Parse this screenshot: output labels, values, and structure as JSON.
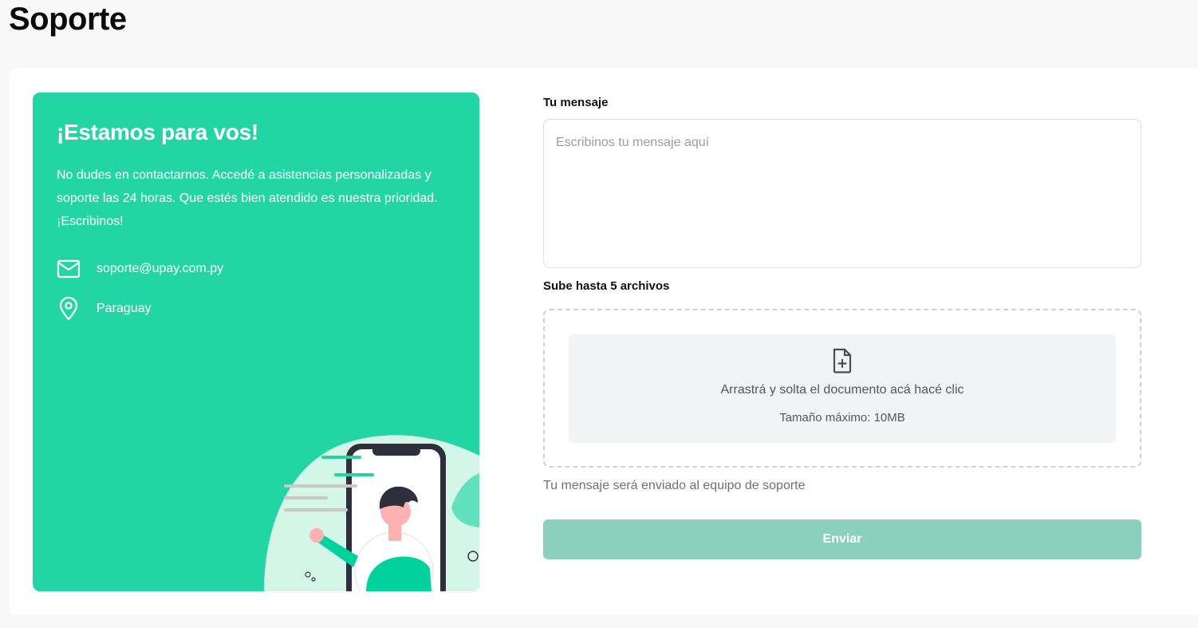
{
  "page": {
    "title": "Soporte"
  },
  "promo": {
    "heading": "¡Estamos para vos!",
    "description": "No dudes en contactarnos. Accedé a asistencias personalizadas y soporte las 24 horas. Que estés bien atendido es nuestra prioridad. ¡Escribinos!",
    "email": "soporte@upay.com.py",
    "location": "Paraguay",
    "email_icon": "mail-icon",
    "location_icon": "map-pin-icon",
    "background_color": "#23d4a4"
  },
  "form": {
    "message_label": "Tu mensaje",
    "message_placeholder": "Escribinos tu mensaje aquí",
    "message_value": "",
    "files_label": "Sube hasta 5 archivos",
    "dropzone_text": "Arrastrá y solta el documento acá hacé clic",
    "dropzone_size": "Tamaño máximo: 10MB",
    "dropzone_icon": "file-plus-icon",
    "helper_text": "Tu mensaje será enviado al equipo de soporte",
    "submit_label": "Enviar",
    "submit_color": "#8bd0bd"
  }
}
